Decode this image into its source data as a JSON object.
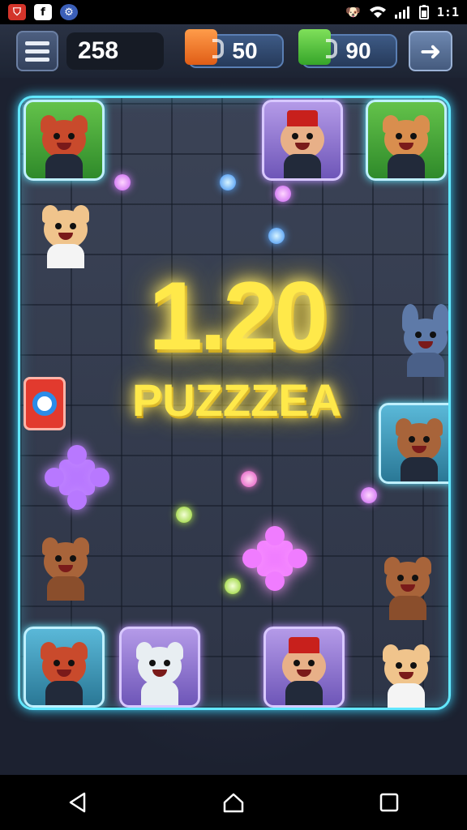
{
  "status_bar": {
    "left_icons": [
      "shield-icon",
      "facebook-icon",
      "app-icon"
    ],
    "right_icons": [
      "dog-notification-icon",
      "wifi-icon",
      "signal-icon",
      "battery-icon"
    ],
    "clock": "1:1"
  },
  "hud": {
    "score": "258",
    "orange_currency": "50",
    "green_currency": "90",
    "menu_icon": "hamburger-icon",
    "back_icon": "back-arrow-icon"
  },
  "board": {
    "level_number": "1.20",
    "title": "PUZZZEA",
    "border_color": "#62e8ff",
    "title_color": "#ffe94a"
  },
  "characters": [
    {
      "name": "red-bear",
      "fur": "red",
      "frame": "green"
    },
    {
      "name": "fez-man-top",
      "fur": "skin",
      "frame": "purple"
    },
    {
      "name": "tan-bear",
      "fur": "tan",
      "frame": "green"
    },
    {
      "name": "cream-dog",
      "fur": "cream",
      "frame": "none"
    },
    {
      "name": "blue-rabbit",
      "fur": "blue",
      "frame": "none"
    },
    {
      "name": "brown-bear-torch",
      "fur": "brown",
      "frame": "teal"
    },
    {
      "name": "brown-bear-left",
      "fur": "brown",
      "frame": "none"
    },
    {
      "name": "brown-bear-right",
      "fur": "brown",
      "frame": "none"
    },
    {
      "name": "red-bear-bottom",
      "fur": "red",
      "frame": "teal"
    },
    {
      "name": "white-cat",
      "fur": "white",
      "frame": "purple"
    },
    {
      "name": "fez-man-bottom",
      "fur": "skin",
      "frame": "purple"
    },
    {
      "name": "cream-cat",
      "fur": "cream",
      "frame": "none"
    }
  ],
  "navigation": {
    "back": "nav-back-icon",
    "home": "nav-home-icon",
    "recents": "nav-recents-icon"
  }
}
